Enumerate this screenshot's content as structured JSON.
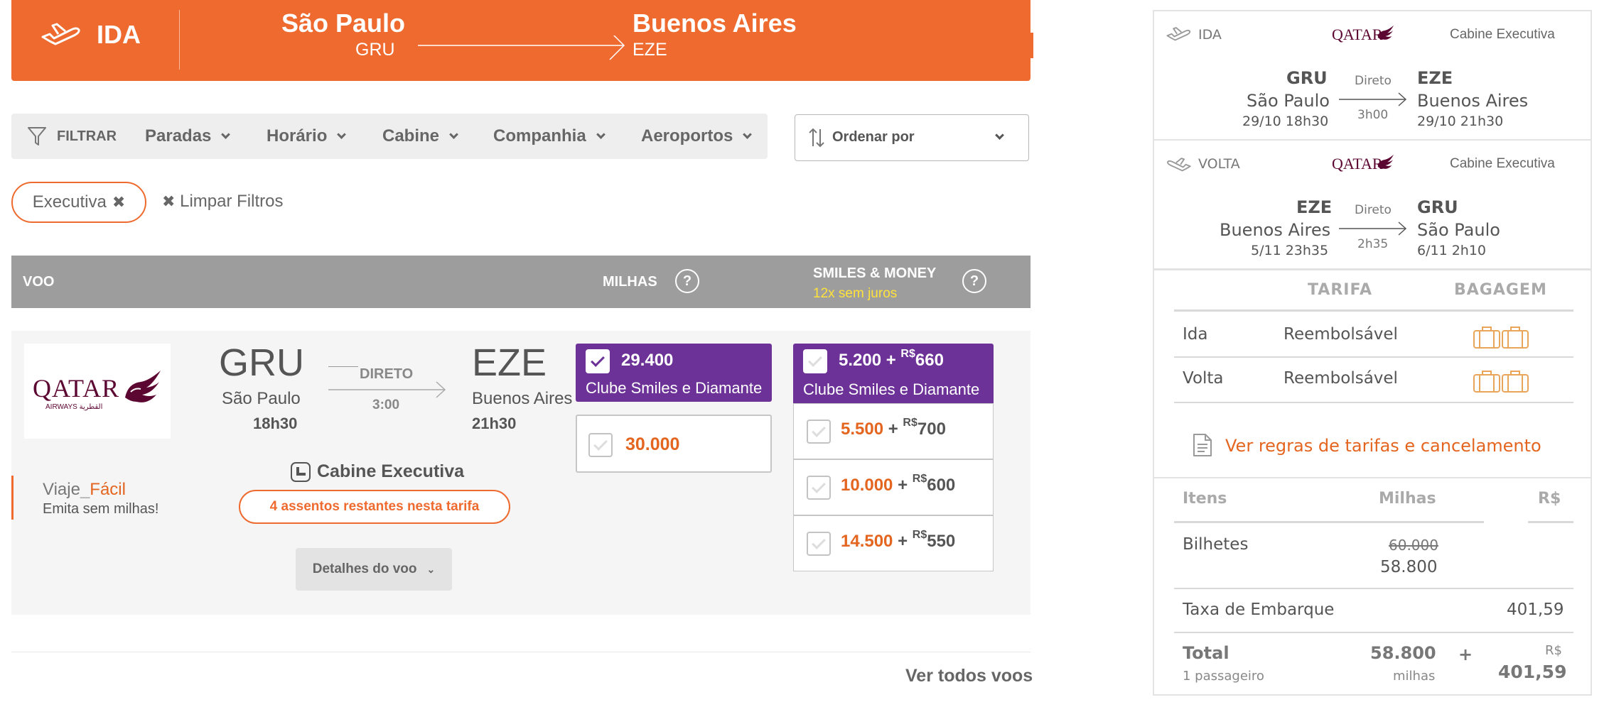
{
  "header": {
    "direction": "IDA",
    "origin_city": "São Paulo",
    "origin_code": "GRU",
    "dest_city": "Buenos Aires",
    "dest_code": "EZE"
  },
  "filters": {
    "filter_label": "FILTRAR",
    "items": [
      "Paradas",
      "Horário",
      "Cabine",
      "Companhia",
      "Aeroportos"
    ],
    "sort_label": "Ordenar por",
    "active_chip": "Executiva",
    "clear_label": "Limpar Filtros"
  },
  "table_header": {
    "flight": "VOO",
    "miles": "MILHAS",
    "smiles_money": "SMILES & MONEY",
    "installments": "12x sem juros",
    "help": "?"
  },
  "flight": {
    "airline": "QATAR",
    "airline_sub": "AIRWAYS القطرية",
    "origin_code": "GRU",
    "origin_city": "São Paulo",
    "origin_time": "18h30",
    "stops": "DIRETO",
    "duration": "3:00",
    "dest_code": "EZE",
    "dest_city": "Buenos Aires",
    "dest_time": "21h30",
    "viaje_prefix": "Viaje",
    "viaje_suffix": "Fácil",
    "viaje_sub": "Emita sem milhas!",
    "cabin": "Cabine Executiva",
    "seats": "4 assentos restantes nesta tarifa",
    "details_button": "Detalhes do voo"
  },
  "miles_options": {
    "selected_value": "29.400",
    "selected_label": "Clube Smiles e Diamante",
    "other_value": "30.000"
  },
  "smiles_money": {
    "selected": {
      "miles": "5.200",
      "plus": "+",
      "currency": "R$",
      "money": "660",
      "label": "Clube Smiles e Diamante"
    },
    "options": [
      {
        "miles": "5.500",
        "plus": "+",
        "currency": "R$",
        "money": "700"
      },
      {
        "miles": "10.000",
        "plus": "+",
        "currency": "R$",
        "money": "600"
      },
      {
        "miles": "14.500",
        "plus": "+",
        "currency": "R$",
        "money": "550"
      }
    ]
  },
  "ver_todos": "Ver todos voos",
  "summary": {
    "outbound": {
      "tag": "IDA",
      "airline": "QATAR",
      "cabin": "Cabine Executiva",
      "from_code": "GRU",
      "from_city": "São Paulo",
      "from_time": "29/10 18h30",
      "stops": "Direto",
      "duration": "3h00",
      "to_code": "EZE",
      "to_city": "Buenos Aires",
      "to_time": "29/10 21h30"
    },
    "inbound": {
      "tag": "VOLTA",
      "airline": "QATAR",
      "cabin": "Cabine Executiva",
      "from_code": "EZE",
      "from_city": "Buenos Aires",
      "from_time": "5/11 23h35",
      "stops": "Direto",
      "duration": "2h35",
      "to_code": "GRU",
      "to_city": "São Paulo",
      "to_time": "6/11 2h10"
    },
    "fare_table": {
      "col_fare": "TARIFA",
      "col_bag": "BAGAGEM",
      "rows": [
        {
          "leg": "Ida",
          "fare": "Reembolsável"
        },
        {
          "leg": "Volta",
          "fare": "Reembolsável"
        }
      ]
    },
    "rules_link": "Ver regras de tarifas e cancelamento",
    "price_table": {
      "col_items": "Itens",
      "col_miles": "Milhas",
      "col_money": "R$",
      "tickets_label": "Bilhetes",
      "tickets_old": "60.000",
      "tickets_new": "58.800",
      "tax_label": "Taxa de Embarque",
      "tax_value": "401,59",
      "total_label": "Total",
      "total_sub": "1 passageiro",
      "total_miles": "58.800",
      "total_miles_unit": "milhas",
      "total_plus": "+",
      "total_currency": "R$",
      "total_money": "401,59"
    }
  },
  "colors": {
    "accent": "#ee6a2e",
    "purple": "#6c3297",
    "header_gray": "#9d9d9d",
    "qatar": "#5c0632"
  }
}
